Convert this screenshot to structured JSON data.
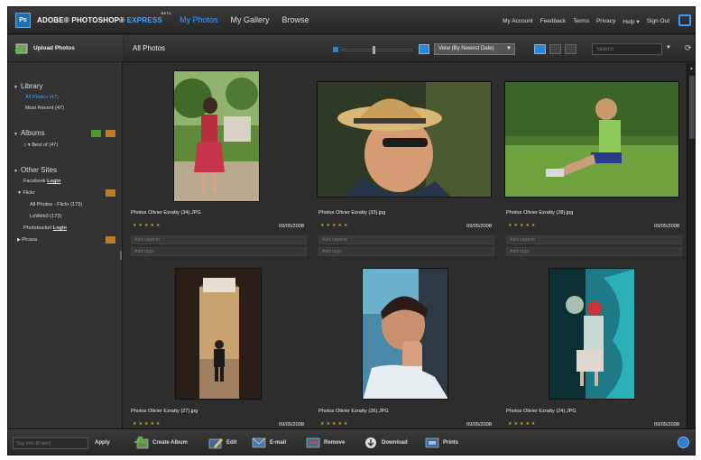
{
  "app": {
    "logo_text": "Ps",
    "brand": "ADOBE® PHOTOSHOP®",
    "brand_express": "EXPRESS",
    "brand_beta": "BETA",
    "nav": [
      "My Photos",
      "My Gallery",
      "Browse"
    ],
    "links": [
      "My Account",
      "Feedback",
      "Terms",
      "Privacy",
      "Help ▾",
      "Sign Out"
    ]
  },
  "sidebar": {
    "upload_label": "Upload Photos",
    "library_title": "Library",
    "library_items": [
      "All Photos (47)",
      "Most Recent (47)"
    ],
    "albums_title": "Albums",
    "album_item": "Best of (47)",
    "other_title": "Other Sites",
    "facebook": "Facebook",
    "login": "Login",
    "flickr": "Flickr",
    "flickr_items": [
      "All Photos - Flickr (173)",
      "LeWeb3 (173)"
    ],
    "photobucket": "Photobucket",
    "picasa": "Picasa"
  },
  "header": {
    "title": "All Photos",
    "view_select": "View (By Newest Date)",
    "search_placeholder": "Search"
  },
  "photos": [
    {
      "title": "Photos Olivier Ezratty (34).JPG",
      "date": "09/05/2008",
      "caption": "Add caption",
      "tags": "Add tags",
      "rating": "★★★★★"
    },
    {
      "title": "Photos Olivier Ezratty (33).jpg",
      "date": "09/05/2008",
      "caption": "Add caption",
      "tags": "Add tags",
      "rating": "★★★★★"
    },
    {
      "title": "Photos Olivier Ezratty (28).jpg",
      "date": "09/05/2008",
      "caption": "Add caption",
      "tags": "Add tags",
      "rating": "★★★★★"
    },
    {
      "title": "Photos Olivier Ezratty (27).jpg",
      "date": "09/05/2008",
      "caption": "",
      "tags": "",
      "rating": "★★★★★"
    },
    {
      "title": "Photos Olivier Ezratty (26).JPG",
      "date": "09/05/2008",
      "caption": "",
      "tags": "",
      "rating": "★★★★★"
    },
    {
      "title": "Photos Olivier Ezratty (24).JPG",
      "date": "09/05/2008",
      "caption": "",
      "tags": "",
      "rating": "★★★★★"
    }
  ],
  "bottom": {
    "tag_placeholder": "Tag Info [Enter]",
    "apply": "Apply",
    "actions": [
      "Create Album",
      "Edit",
      "E-mail",
      "Remove",
      "Download",
      "Prints"
    ]
  }
}
